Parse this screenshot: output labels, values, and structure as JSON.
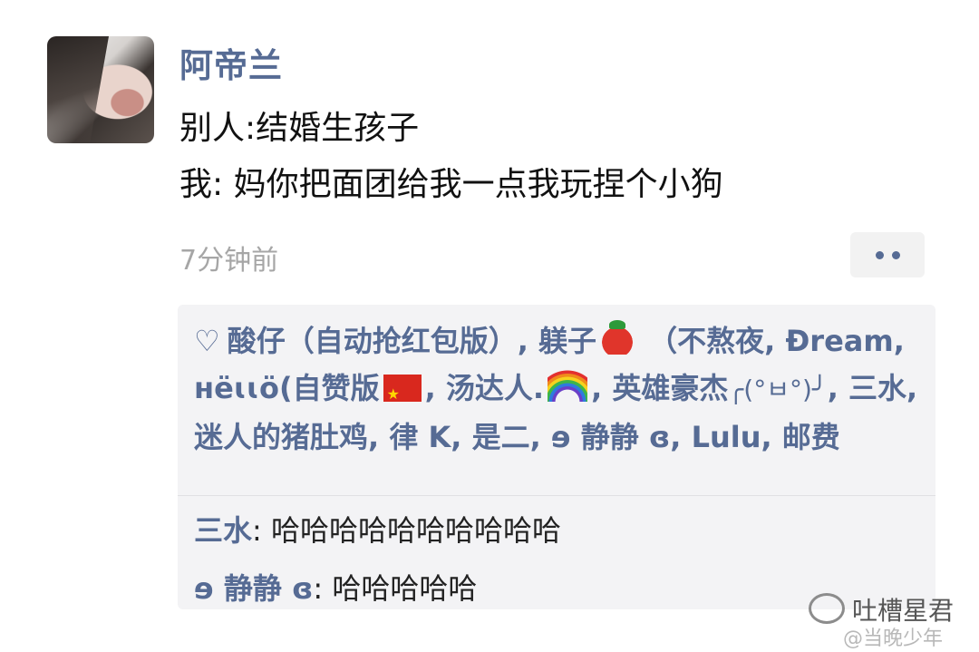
{
  "post": {
    "nickname": "阿帝兰",
    "line1": "别人:结婚生孩子",
    "line2": "我: 妈你把面团给我一点我玩捏个小狗",
    "timestamp": "7分钟前"
  },
  "likes": {
    "heart_icon": "heart-outline-icon",
    "names": [
      "酸仔（自动抢红包版）",
      "躾子",
      "（不熬夜",
      "Ðream",
      "нёɩɩö(自赞版",
      "汤达人.",
      "英雄豪杰",
      "╭(°ㅂ°)╯",
      "三水",
      "迷人的猪肚鸡",
      "律 K",
      "是二",
      "ɘ 静静 ɞ",
      "Lulu",
      "邮费"
    ],
    "separator": ", "
  },
  "comments": [
    {
      "author": "三水",
      "text": "哈哈哈哈哈哈哈哈哈哈"
    },
    {
      "author": "ɘ 静静 ɞ",
      "text": "哈哈哈哈哈"
    }
  ],
  "watermark": {
    "title": "吐槽星君",
    "subtitle": "@当晚少年"
  },
  "colors": {
    "link_blue": "#566b94",
    "timestamp_gray": "#a6a6a6",
    "box_bg": "#f3f3f5"
  }
}
